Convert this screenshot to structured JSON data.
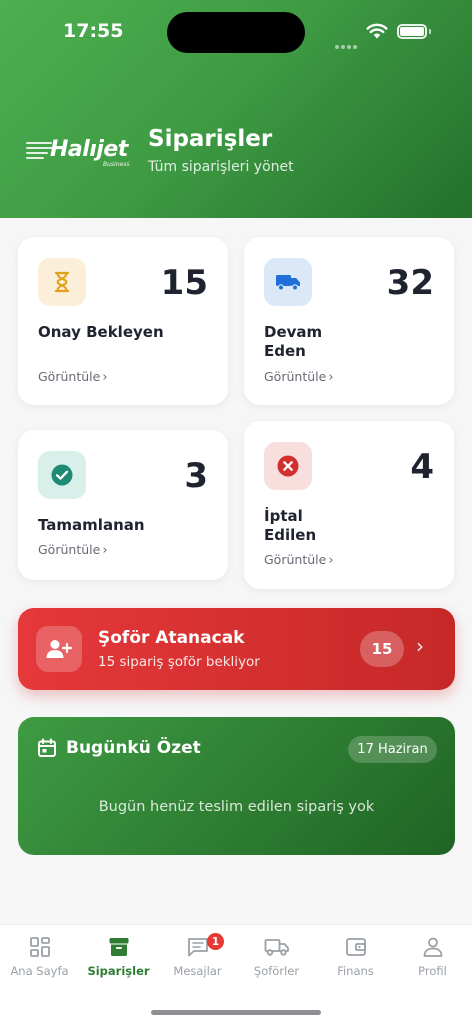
{
  "status_bar": {
    "time": "17:55"
  },
  "header": {
    "logo_text": "Halıjet",
    "logo_sub": "Business",
    "title": "Siparişler",
    "subtitle": "Tüm siparişleri yönet"
  },
  "cards": [
    {
      "count": "15",
      "label": "Onay Bekleyen",
      "link": "Görüntüle",
      "icon": "hourglass-icon",
      "color": "#e0a019",
      "bg": "#fbefd9"
    },
    {
      "count": "32",
      "label": "Devam Eden",
      "link": "Görüntüle",
      "icon": "truck-icon",
      "color": "#1e6fd9",
      "bg": "#dbe8f8"
    },
    {
      "count": "3",
      "label": "Tamamlanan",
      "link": "Görüntüle",
      "icon": "check-circle-icon",
      "color": "#1d8a74",
      "bg": "#d9efea"
    },
    {
      "count": "4",
      "label": "İptal Edilen",
      "link": "Görüntüle",
      "icon": "cancel-circle-icon",
      "color": "#d32f2f",
      "bg": "#f9dede"
    }
  ],
  "driver_banner": {
    "title": "Şoför Atanacak",
    "subtitle": "15 sipariş şoför bekliyor",
    "count": "15"
  },
  "summary": {
    "title": "Bugünkü Özet",
    "date": "17 Haziran",
    "empty_text": "Bugün henüz teslim edilen sipariş yok"
  },
  "tabbar": {
    "items": [
      {
        "label": "Ana Sayfa",
        "icon": "dashboard-icon"
      },
      {
        "label": "Siparişler",
        "icon": "archive-box-icon",
        "active": true
      },
      {
        "label": "Mesajlar",
        "icon": "chat-icon",
        "badge": "1"
      },
      {
        "label": "Şoförler",
        "icon": "truck-icon"
      },
      {
        "label": "Finans",
        "icon": "wallet-icon"
      },
      {
        "label": "Profil",
        "icon": "user-icon"
      }
    ]
  },
  "colors": {
    "primary_green": "#2e7d32",
    "danger_red": "#d32f2f"
  }
}
